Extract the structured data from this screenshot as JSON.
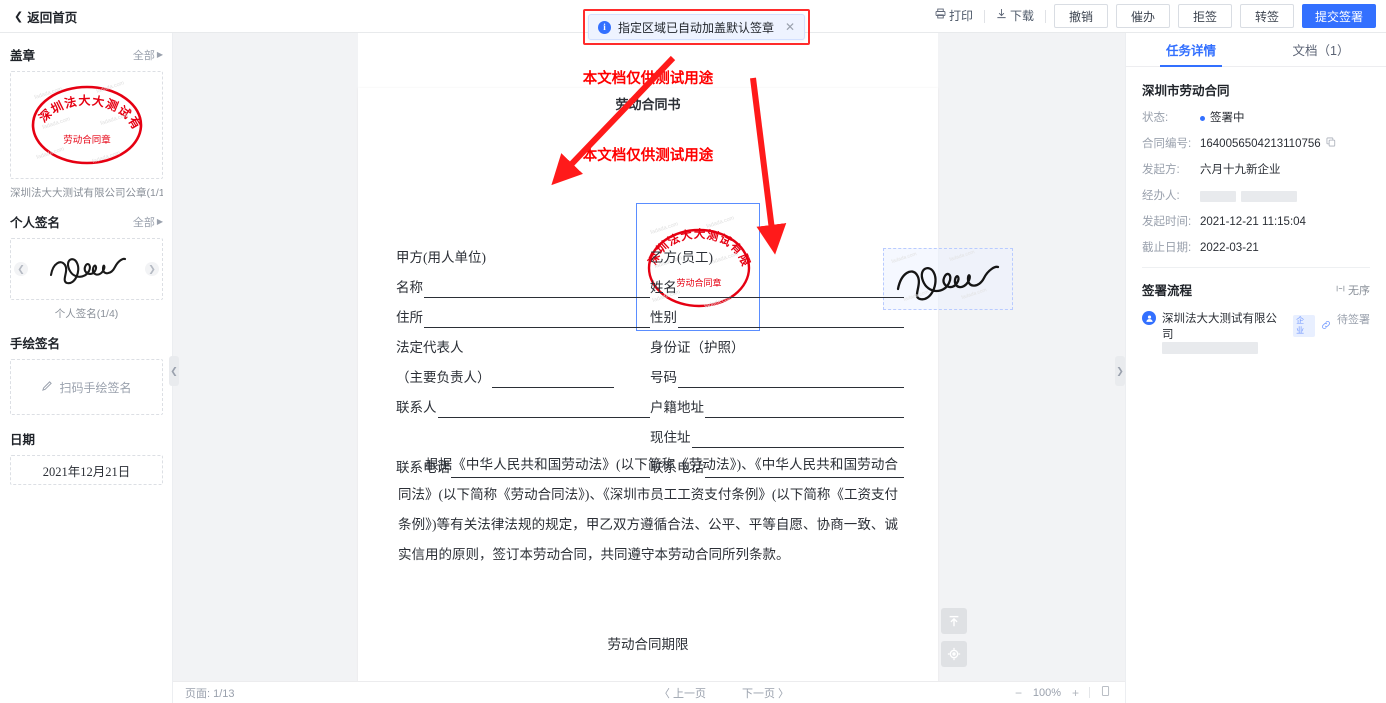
{
  "topbar": {
    "back_label": "返回首页",
    "back_icon": "chevron-left-icon",
    "print_label": "打印",
    "print_icon": "printer-icon",
    "download_label": "下载",
    "download_icon": "download-icon",
    "buttons": [
      {
        "label": "撤销",
        "primary": false
      },
      {
        "label": "催办",
        "primary": false
      },
      {
        "label": "拒签",
        "primary": false
      },
      {
        "label": "转签",
        "primary": false
      },
      {
        "label": "提交签署",
        "primary": true
      }
    ],
    "primary_color": "#3370ff"
  },
  "notice": {
    "icon": "info-icon",
    "text": "指定区域已自动加盖默认签章",
    "close_icon": "close-icon",
    "highlight_color": "#ff2b2b"
  },
  "sidebar": {
    "seal_section": {
      "title": "盖章",
      "all_label": "全部",
      "caption": "深圳法大大测试有限公司公章(1/1)",
      "seal_top_text": "深圳法大大测试有限公司",
      "seal_bottom_text": "劳动合同章",
      "seal_color": "#e60012",
      "watermark": "fadada.com"
    },
    "personal_section": {
      "title": "个人签名",
      "all_label": "全部",
      "caption": "个人签名(1/4)",
      "prev_icon": "chevron-left-icon",
      "next_icon": "chevron-right-icon"
    },
    "handdraw_section": {
      "title": "手绘签名",
      "action_label": "扫码手绘签名",
      "action_icon": "pen-icon"
    },
    "date_section": {
      "title": "日期",
      "value": "2021年12月21日"
    }
  },
  "viewer": {
    "collapse_left_icon": "chevron-left-icon",
    "collapse_right_icon": "chevron-right-icon",
    "float_buttons": [
      {
        "icon": "scroll-to-top-icon",
        "name": "scroll-to-top-button"
      },
      {
        "icon": "locate-icon",
        "name": "locate-signature-button"
      }
    ],
    "watermark_top": "本文档仅供测试用途",
    "watermark_mid": "本文档仅供测试用途",
    "doc_heading": "劳动合同书",
    "form": {
      "left": [
        {
          "label": "甲方(用人单位)",
          "line": false
        },
        {
          "label": "名称",
          "line": true
        },
        {
          "label": "住所",
          "line": true
        },
        {
          "label": "法定代表人",
          "line": false
        },
        {
          "label": "（主要负责人）",
          "line": true,
          "short": true
        },
        {
          "label": "联系人",
          "line": true
        },
        {
          "label": "",
          "line": false
        },
        {
          "label": "联系电话",
          "line": true
        }
      ],
      "right": [
        {
          "label": "乙方(员工)",
          "line": false
        },
        {
          "label": "姓名",
          "line": true
        },
        {
          "label": "性别",
          "line": true
        },
        {
          "label": "身份证（护照）",
          "line": false
        },
        {
          "label": "号码",
          "line": true
        },
        {
          "label": "户籍地址",
          "line": true
        },
        {
          "label": "现住址",
          "line": true
        },
        {
          "label": "联系电话",
          "line": true
        }
      ]
    },
    "paragraph": "根据《中华人民共和国劳动法》(以下简称《劳动法》)、《中华人民共和国劳动合同法》(以下简称《劳动合同法》)、《深圳市员工工资支付条例》(以下简称《工资支付条例》)等有关法律法规的规定，甲乙双方遵循合法、公平、平等自愿、协商一致、诚实信用的原则，签订本劳动合同，共同遵守本劳动合同所列条款。",
    "next_heading": "劳动合同期限"
  },
  "footer": {
    "page_label": "页面: 1/13",
    "prev_page": "〈 上一页",
    "next_page": "下一页 〉",
    "zoom_out": "−",
    "zoom_value": "100%",
    "zoom_in": "+",
    "fit_icon": "fit-page-icon"
  },
  "right_panel": {
    "tabs": [
      {
        "label": "任务详情",
        "active": true
      },
      {
        "label": "文档（1）",
        "active": false
      }
    ],
    "doc_title": "深圳市劳动合同",
    "fields": [
      {
        "key": "状态:",
        "value": "签署中",
        "type": "status"
      },
      {
        "key": "合同编号:",
        "value": "1640056504213110756",
        "type": "copyable"
      },
      {
        "key": "发起方:",
        "value": "六月十九新企业",
        "type": "text"
      },
      {
        "key": "经办人:",
        "value": "",
        "type": "redacted"
      },
      {
        "key": "发起时间:",
        "value": "2021-12-21 11:15:04",
        "type": "text"
      },
      {
        "key": "截止日期:",
        "value": "2022-03-21",
        "type": "text"
      }
    ],
    "flow": {
      "title": "签署流程",
      "order_label": "无序",
      "order_icon": "unordered-icon",
      "items": [
        {
          "avatar_icon": "user-icon",
          "name": "深圳法大大测试有限公司",
          "badge": "企业",
          "link_icon": "link-icon",
          "status": "待签署"
        }
      ]
    }
  }
}
